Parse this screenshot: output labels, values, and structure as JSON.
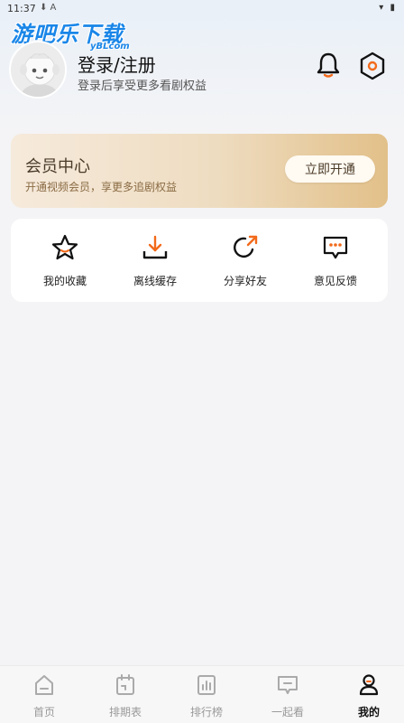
{
  "status_bar": {
    "time": "11:37",
    "left_icons": "⬇ A",
    "right_icons": "▾ ▮"
  },
  "watermark": {
    "text": "游吧乐下载",
    "sub": "yBLcom"
  },
  "profile": {
    "title": "登录/注册",
    "subtitle": "登录后享受更多看剧权益"
  },
  "vip": {
    "title": "会员中心",
    "subtitle": "开通视频会员，享更多追剧权益",
    "button": "立即开通"
  },
  "quick_actions": [
    {
      "label": "我的收藏",
      "icon": "star-icon"
    },
    {
      "label": "离线缓存",
      "icon": "download-icon"
    },
    {
      "label": "分享好友",
      "icon": "share-icon"
    },
    {
      "label": "意见反馈",
      "icon": "feedback-icon"
    }
  ],
  "tabs": [
    {
      "label": "首页",
      "icon": "home-icon"
    },
    {
      "label": "排期表",
      "icon": "calendar-icon"
    },
    {
      "label": "排行榜",
      "icon": "ranking-icon"
    },
    {
      "label": "一起看",
      "icon": "watch-together-icon"
    },
    {
      "label": "我的",
      "icon": "profile-icon"
    }
  ],
  "colors": {
    "accent": "#f26a1b",
    "vip_gold": "#e2c089",
    "watermark_blue": "#1a86e8"
  }
}
